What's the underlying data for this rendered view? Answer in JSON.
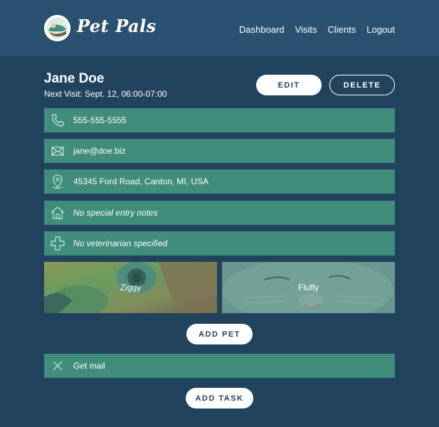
{
  "header": {
    "brand": "Pet Pals",
    "nav": [
      "Dashboard",
      "Visits",
      "Clients",
      "Logout"
    ]
  },
  "client": {
    "name": "Jane Doe",
    "next_visit": "Next Visit: Sept. 12, 06:00-07:00",
    "edit_label": "EDIT",
    "delete_label": "DELETE",
    "details": [
      {
        "icon": "phone-icon",
        "text": "555-555-5555",
        "italic": false
      },
      {
        "icon": "mail-icon",
        "text": "jane@doe.biz",
        "italic": false
      },
      {
        "icon": "location-pin-icon",
        "text": "45345 Ford Road, Canton, MI, USA",
        "italic": false
      },
      {
        "icon": "house-icon",
        "text": "No special entry notes",
        "italic": true
      },
      {
        "icon": "medical-cross-icon",
        "text": "No veterinarian specified",
        "italic": true
      }
    ]
  },
  "pets": [
    {
      "name": "Ziggy",
      "photo": "parrot"
    },
    {
      "name": "Fluffy",
      "photo": "cat"
    }
  ],
  "add_pet_label": "ADD PET",
  "tasks": [
    {
      "icon": "x-icon",
      "text": "Get mail"
    }
  ],
  "add_task_label": "ADD TASK",
  "colors": {
    "background": "#22435e",
    "header": "#2a5170",
    "row": "#3f8d7a",
    "text": "#ffffff"
  }
}
